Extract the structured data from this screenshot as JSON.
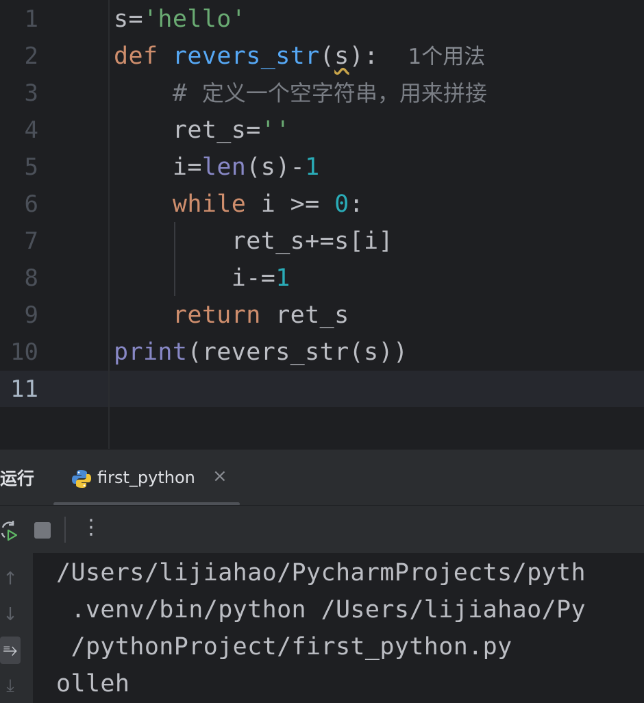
{
  "editor": {
    "line_numbers": [
      "1",
      "2",
      "3",
      "4",
      "5",
      "6",
      "7",
      "8",
      "9",
      "10",
      "11"
    ],
    "lines": {
      "l1": {
        "a": "s=",
        "b": "'hello'"
      },
      "l2": {
        "kw": "def",
        "fn": "revers_str",
        "p1": "(",
        "param": "s",
        "p2": "):",
        "hint": "1个用法"
      },
      "l3": {
        "hash": "#",
        "text": "定义一个空字符串，用来拼接"
      },
      "l4": {
        "a": "ret_s=",
        "b": "''"
      },
      "l5": {
        "a": "i=",
        "bi": "len",
        "b": "(s)-",
        "n": "1"
      },
      "l6": {
        "kw": "while",
        "a": " i >= ",
        "n": "0",
        "b": ":"
      },
      "l7": {
        "a": "ret_s+=s[i]"
      },
      "l8": {
        "a": "i-=",
        "n": "1"
      },
      "l9": {
        "kw": "return",
        "a": " ret_s"
      },
      "l10": {
        "bi": "print",
        "a": "(revers_str(s))"
      }
    }
  },
  "run_panel": {
    "title": "运行",
    "tab_label": "first_python",
    "tab_close": "×",
    "toolbar": {
      "more": "⋮"
    },
    "side": {
      "up": "↑",
      "down": "↓",
      "wrap": "⥱",
      "scroll_end": "⤓"
    },
    "output": [
      "/Users/lijiahao/PycharmProjects/pyth",
      " .venv/bin/python /Users/lijiahao/Py",
      " /pythonProject/first_python.py",
      "olleh"
    ]
  },
  "colors": {
    "keyword": "#cf8e6d",
    "function": "#56a8f5",
    "string": "#6aab73",
    "number": "#2aacb8",
    "builtin": "#8888c6",
    "comment": "#7a7e85"
  }
}
